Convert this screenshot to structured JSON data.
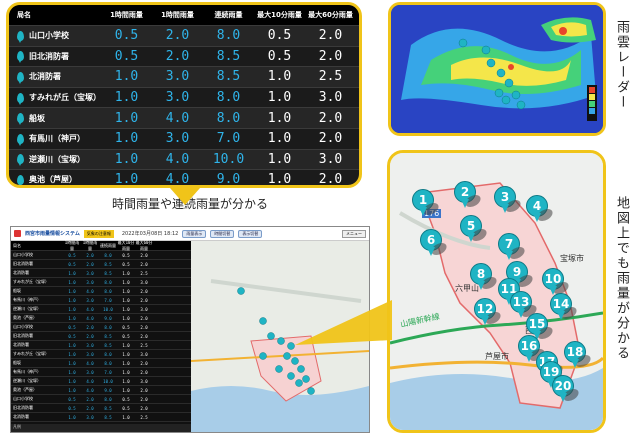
{
  "table": {
    "headers": [
      "局名",
      "1時間雨量",
      "1時間雨量",
      "連続雨量",
      "最大10分雨量",
      "最大60分雨量"
    ],
    "rows": [
      {
        "name": "山口小学校",
        "v": [
          "0.5",
          "2.0",
          "8.0",
          "0.5",
          "2.0"
        ]
      },
      {
        "name": "旧北消防署",
        "v": [
          "0.5",
          "2.0",
          "8.5",
          "0.5",
          "2.0"
        ]
      },
      {
        "name": "北消防署",
        "v": [
          "1.0",
          "3.0",
          "8.5",
          "1.0",
          "2.5"
        ]
      },
      {
        "name": "すみれが丘（宝塚）",
        "v": [
          "1.0",
          "3.0",
          "8.0",
          "1.0",
          "3.0"
        ]
      },
      {
        "name": "船坂",
        "v": [
          "1.0",
          "4.0",
          "8.0",
          "1.0",
          "2.0"
        ]
      },
      {
        "name": "有馬川（神戸）",
        "v": [
          "1.0",
          "3.0",
          "7.0",
          "1.0",
          "2.0"
        ]
      },
      {
        "name": "逆瀬川（宝塚）",
        "v": [
          "1.0",
          "4.0",
          "10.0",
          "1.0",
          "3.0"
        ]
      },
      {
        "name": "奥池（芦屋）",
        "v": [
          "1.0",
          "4.0",
          "9.0",
          "1.0",
          "2.0"
        ]
      }
    ]
  },
  "captions": {
    "hourly": "時間雨量や連続雨量が分かる",
    "radar": "雨雲レーダー",
    "map": "地図上でも雨量が分かる"
  },
  "app": {
    "title": "西宮市雨量情報システム",
    "badge": "気象の注意報",
    "date": "2022年03月08日 18:12",
    "buttons": [
      "雨量表示",
      "時間切替",
      "表示切替"
    ],
    "menu": "メニュー",
    "footer": "凡例"
  },
  "map": {
    "pins": [
      "1",
      "2",
      "3",
      "4",
      "5",
      "6",
      "7",
      "8",
      "9",
      "10",
      "11",
      "12",
      "13",
      "14",
      "15",
      "16",
      "17",
      "18",
      "19",
      "20"
    ],
    "labels": {
      "takarazuka": "宝塚市",
      "rokko": "六甲山",
      "ashiya": "芦屋市",
      "nishi": "西",
      "route": "176",
      "shinkansen": "山陽新幹線"
    }
  },
  "colors": {
    "accent": "#f0c419",
    "pin": "#1fb4c4",
    "value": "#2fb4ea"
  }
}
